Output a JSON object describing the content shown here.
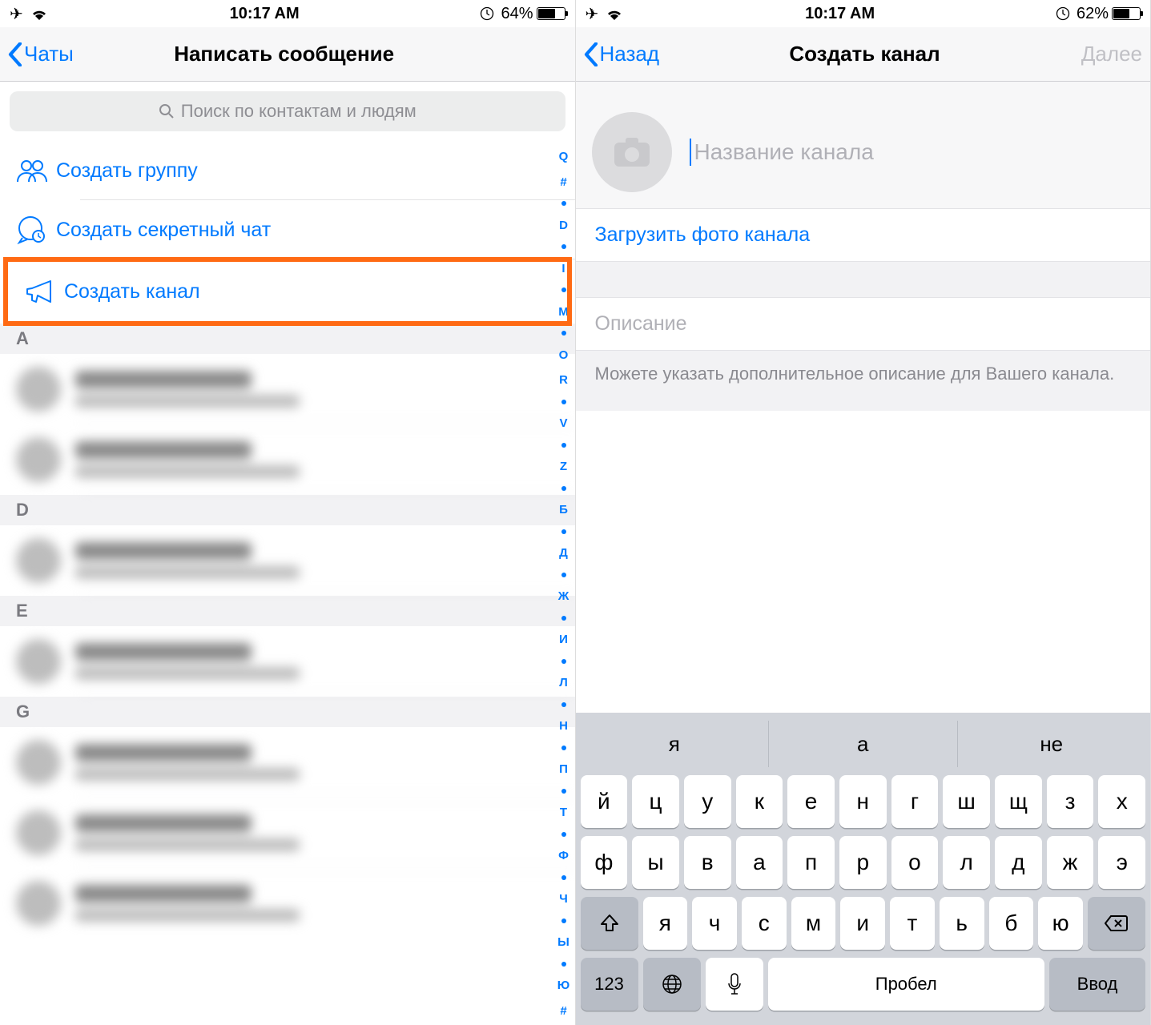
{
  "left": {
    "status": {
      "time": "10:17 AM",
      "battery_pct": "64%",
      "battery_fill": 64
    },
    "nav": {
      "back": "Чаты",
      "title": "Написать сообщение"
    },
    "search_placeholder": "Поиск по контактам и людям",
    "actions": [
      {
        "icon": "group",
        "label": "Создать группу"
      },
      {
        "icon": "secret",
        "label": "Создать секретный чат"
      },
      {
        "icon": "channel",
        "label": "Создать канал"
      }
    ],
    "sections": [
      "A",
      "D",
      "E",
      "G"
    ],
    "index_strip": [
      "Q",
      "#",
      "●",
      "D",
      "●",
      "I",
      "●",
      "M",
      "●",
      "O",
      "R",
      "●",
      "V",
      "●",
      "Z",
      "●",
      "Б",
      "●",
      "Д",
      "●",
      "Ж",
      "●",
      "И",
      "●",
      "Л",
      "●",
      "Н",
      "●",
      "П",
      "●",
      "Т",
      "●",
      "Ф",
      "●",
      "Ч",
      "●",
      "Ы",
      "●",
      "Ю",
      "#"
    ]
  },
  "right": {
    "status": {
      "time": "10:17 AM",
      "battery_pct": "62%",
      "battery_fill": 62
    },
    "nav": {
      "back": "Назад",
      "title": "Создать канал",
      "next": "Далее"
    },
    "name_placeholder": "Название канала",
    "upload_label": "Загрузить фото канала",
    "desc_placeholder": "Описание",
    "desc_help": "Можете указать дополнительное описание для Вашего канала.",
    "keyboard": {
      "suggestions": [
        "я",
        "а",
        "не"
      ],
      "row1": [
        "й",
        "ц",
        "у",
        "к",
        "е",
        "н",
        "г",
        "ш",
        "щ",
        "з",
        "х"
      ],
      "row2": [
        "ф",
        "ы",
        "в",
        "а",
        "п",
        "р",
        "о",
        "л",
        "д",
        "ж",
        "э"
      ],
      "row3": [
        "я",
        "ч",
        "с",
        "м",
        "и",
        "т",
        "ь",
        "б",
        "ю"
      ],
      "key_123": "123",
      "space": "Пробел",
      "enter": "Ввод"
    }
  }
}
